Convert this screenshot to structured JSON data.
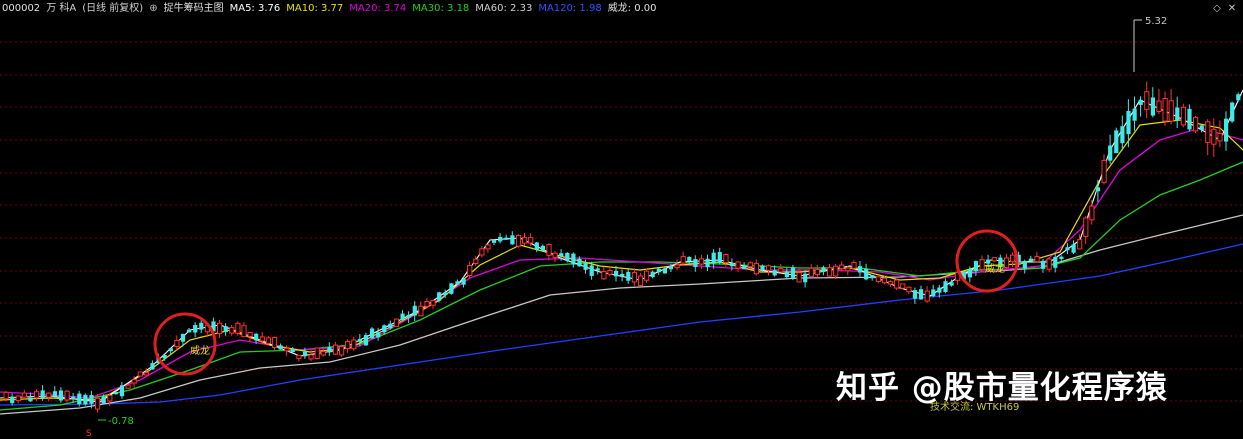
{
  "header": {
    "stock_code": "000002",
    "stock_name": "万 科A",
    "period": "(日线 前复权)",
    "indicator_name": "捉牛筹码主图",
    "ma": [
      {
        "label": "MA5: 3.76",
        "color": "#ffffff"
      },
      {
        "label": "MA10: 3.77",
        "color": "#e8e000"
      },
      {
        "label": "MA20: 3.74",
        "color": "#e000e0"
      },
      {
        "label": "MA30: 3.18",
        "color": "#20d020"
      },
      {
        "label": "MA60: 2.33",
        "color": "#d0d0d0"
      },
      {
        "label": "MA120: 1.98",
        "color": "#2040ff"
      }
    ],
    "signal": "威龙: 0.00"
  },
  "annotations": {
    "high_price": "5.32",
    "low_price": "-0.78",
    "signal_tag_1": "威龙",
    "signal_tag_2": "威龙",
    "bottom_text": "技术交流: WTKH69"
  },
  "watermark": "知乎 @股市量化程序猿",
  "colors": {
    "up": "#ff3030",
    "down": "#40e8e8",
    "grid": "#7a0000",
    "highlight_circle": "#e02020"
  }
}
